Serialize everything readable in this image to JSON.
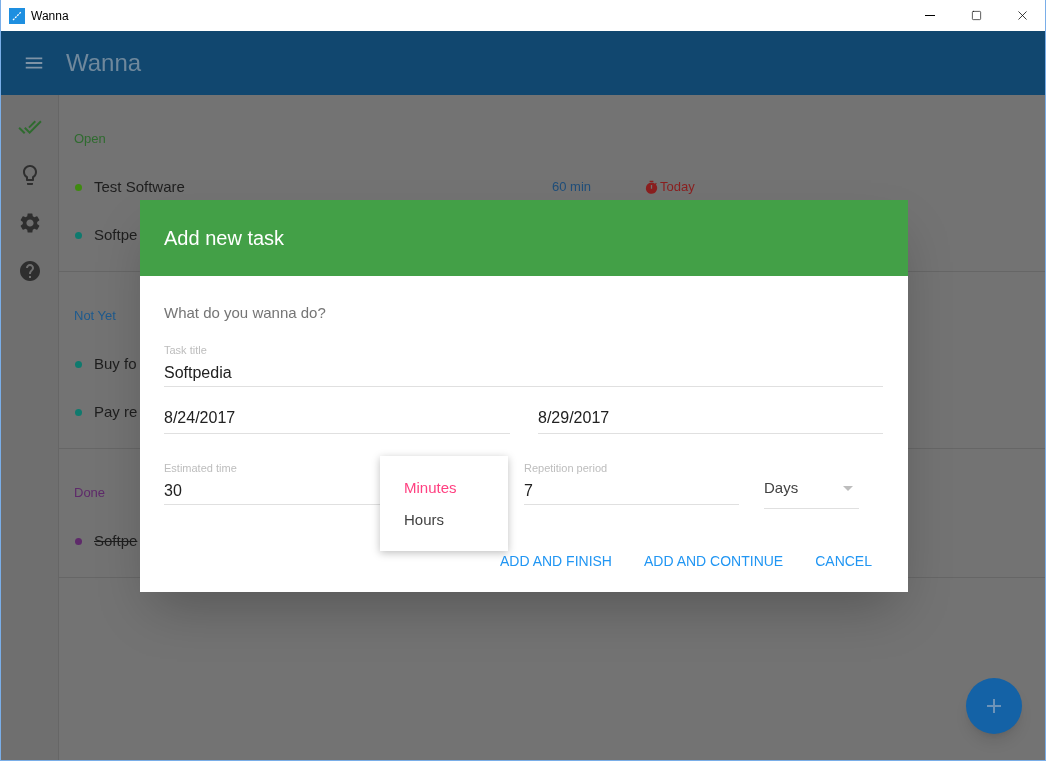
{
  "window": {
    "title": "Wanna"
  },
  "app_bar": {
    "title": "Wanna"
  },
  "sidebar": {
    "items": [
      {
        "kind": "tasks",
        "selected": true
      },
      {
        "kind": "ideas",
        "selected": false
      },
      {
        "kind": "settings",
        "selected": false
      },
      {
        "kind": "help",
        "selected": false
      }
    ]
  },
  "sections": [
    {
      "label": "Open",
      "color": "#2f6b2f",
      "items": [
        {
          "name": "Test Software",
          "color": "#3f8a10",
          "done": false,
          "estimate": "60 min",
          "due": "Today"
        },
        {
          "name": "Softpe",
          "color": "#0f7a6e",
          "done": false
        }
      ]
    },
    {
      "label": "Not Yet",
      "color": "#1d5a8e",
      "items": [
        {
          "name": "Buy fo",
          "color": "#0f7a6e",
          "done": false
        },
        {
          "name": "Pay re",
          "color": "#0f7a6e",
          "done": false
        }
      ]
    },
    {
      "label": "Done",
      "color": "#5e2a6a",
      "items": [
        {
          "name": "Softpe",
          "color": "#5e2a6a",
          "done": true
        }
      ]
    }
  ],
  "dialog": {
    "title": "Add new task",
    "prompt": "What do you wanna do?",
    "task_title": {
      "label": "Task title",
      "value": "Softpedia"
    },
    "start_date": {
      "value": "8/24/2017"
    },
    "end_date": {
      "value": "8/29/2017"
    },
    "estimated_time": {
      "label": "Estimated time",
      "value": "30"
    },
    "unit_menu": [
      {
        "label": "Minutes",
        "selected": true
      },
      {
        "label": "Hours",
        "selected": false
      }
    ],
    "repetition_period": {
      "label": "Repetition period",
      "value": "7"
    },
    "repetition_unit": {
      "value": "Days"
    },
    "buttons": [
      "ADD AND FINISH",
      "ADD AND CONTINUE",
      "CANCEL"
    ]
  }
}
